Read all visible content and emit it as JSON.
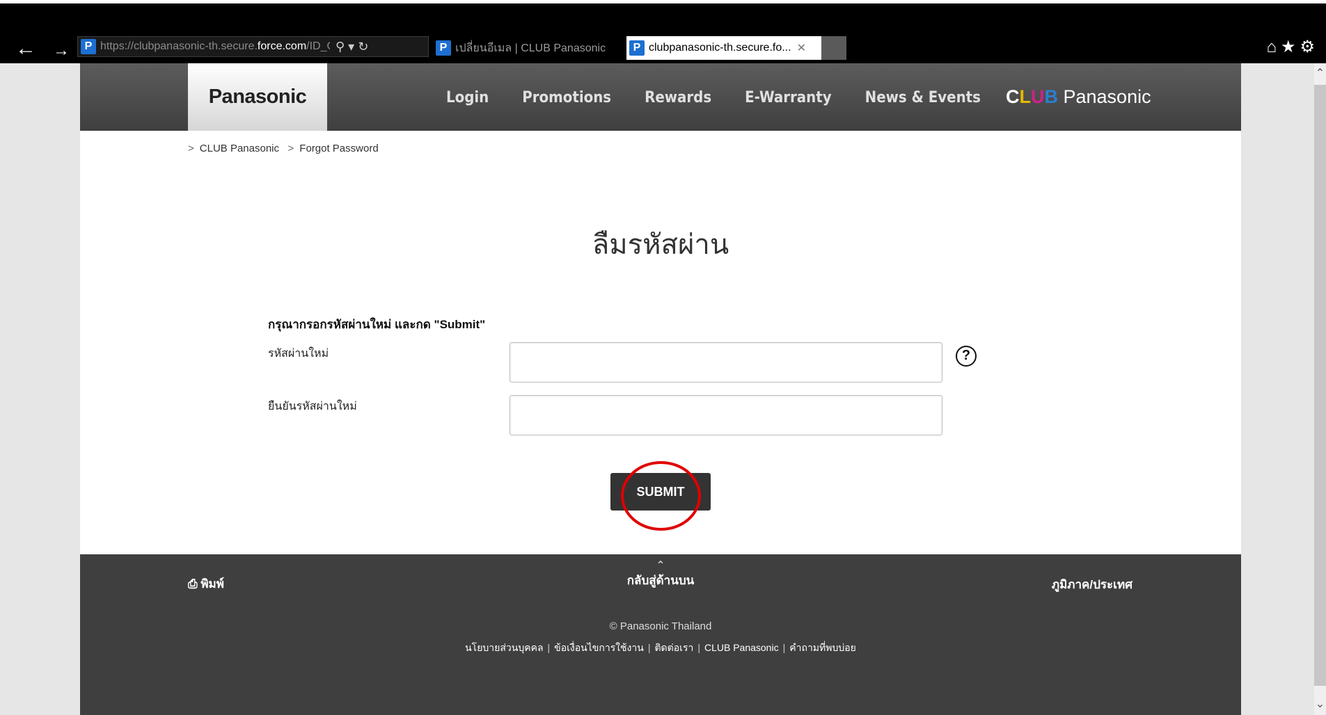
{
  "browser": {
    "url_prefix": "https://clubpanasonic-th.secure.",
    "url_domain": "force.com",
    "url_suffix": "/ID_Changi",
    "tab1_title": "เปลี่ยนอีเมล | CLUB Panasonic",
    "tab2_title": "clubpanasonic-th.secure.fo...",
    "favicon_letter": "P"
  },
  "header": {
    "logo": "Panasonic",
    "nav": [
      "Login",
      "Promotions",
      "Rewards",
      "E-Warranty",
      "News & Events"
    ],
    "club_logo_c": "C",
    "club_logo_l": "L",
    "club_logo_u": "U",
    "club_logo_b": "B",
    "club_logo_rest": " Panasonic"
  },
  "breadcrumb": {
    "item1": "CLUB Panasonic",
    "item2": "Forgot Password"
  },
  "form": {
    "title": "ลืมรหัสผ่าน",
    "instruction": "กรุณากรอกรหัสผ่านใหม่ และกด \"Submit\"",
    "new_password_label": "รหัสผ่านใหม่",
    "confirm_password_label": "ยืนยันรหัสผ่านใหม่",
    "help_symbol": "?",
    "submit_label": "SUBMIT"
  },
  "footer": {
    "print": "พิมพ์",
    "back_to_top": "กลับสู่ด้านบน",
    "region": "ภูมิภาค/ประเทศ",
    "copyright": "© Panasonic Thailand",
    "links": [
      "นโยบายส่วนบุคคล",
      "ข้อเงื่อนไขการใช้งาน",
      "ติดต่อเรา",
      "CLUB Panasonic",
      "คำถามที่พบบ่อย"
    ]
  },
  "colors": {
    "header_bg": "#4a4a4a",
    "submit_bg": "#333333",
    "highlight_circle": "#e00000",
    "footer_bg": "#3f3f3f"
  }
}
